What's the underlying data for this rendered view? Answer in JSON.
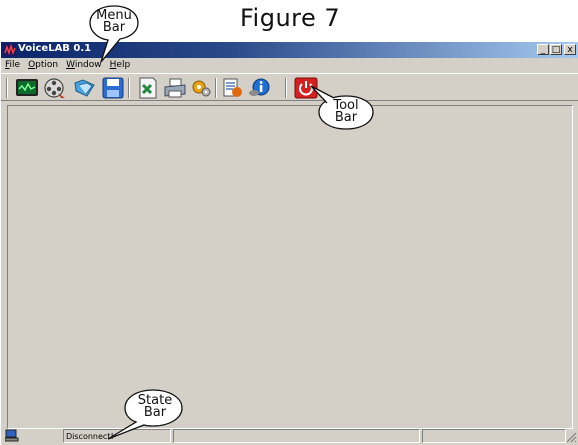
{
  "figure": {
    "title": "Figure 7"
  },
  "window": {
    "title": "VoiceLAB 0.1",
    "buttons": [
      "_",
      "□",
      "x"
    ]
  },
  "menu": {
    "items": [
      "File",
      "Option",
      "Window",
      "Help"
    ]
  },
  "toolbar": {
    "buttons": [
      "monitor-icon",
      "film-reel-icon",
      "open-folder-icon",
      "save-disk-icon",
      "spreadsheet-icon",
      "print-icon",
      "settings-gear-icon",
      "report-icon",
      "info-icon",
      "power-icon"
    ]
  },
  "status": {
    "connection": "Disconnect!"
  },
  "callouts": {
    "menu": {
      "line1": "Menu",
      "line2": "Bar"
    },
    "tool": {
      "line1": "Tool",
      "line2": "Bar"
    },
    "state": {
      "line1": "State",
      "line2": "Bar"
    }
  },
  "colors": {
    "titlebar_start": "#0a246a",
    "titlebar_end": "#a6caf0",
    "face": "#d4d0c8",
    "power": "#d42020"
  }
}
